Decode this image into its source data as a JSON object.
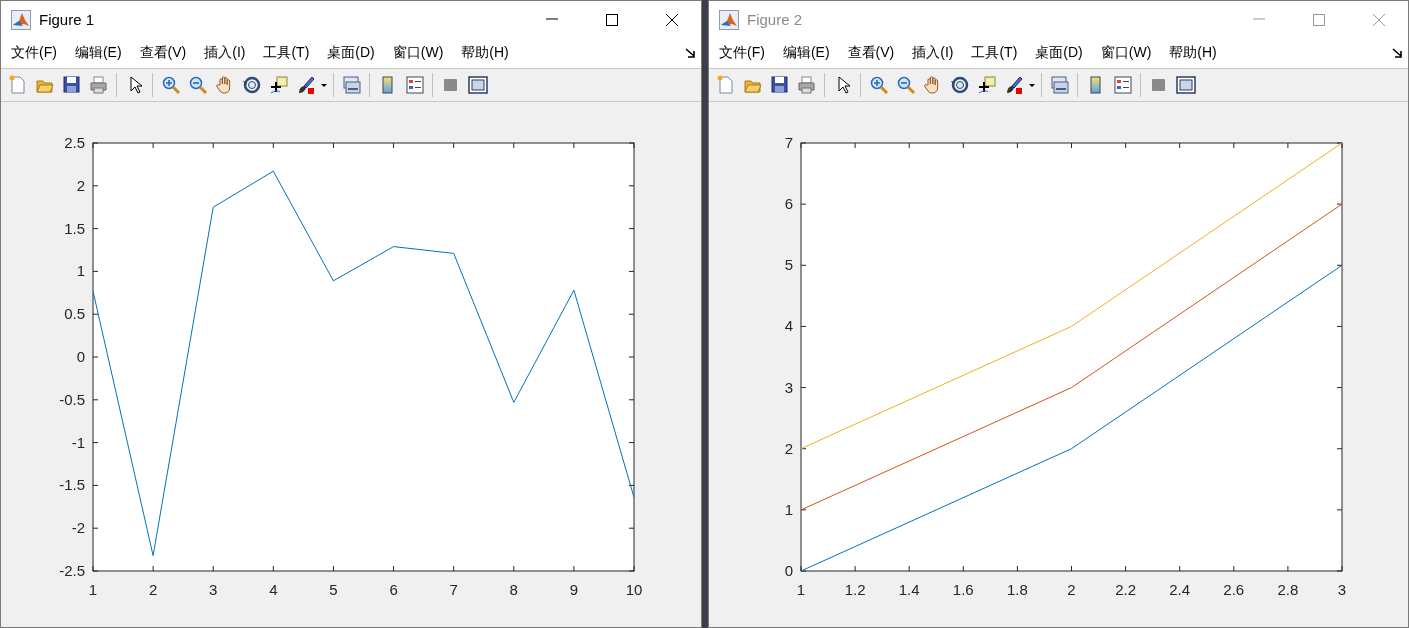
{
  "windows": [
    {
      "title": "Figure 1",
      "active": true,
      "menu": [
        "文件(F)",
        "编辑(E)",
        "查看(V)",
        "插入(I)",
        "工具(T)",
        "桌面(D)",
        "窗口(W)",
        "帮助(H)"
      ],
      "chart_data": {
        "type": "line",
        "x": [
          1,
          2,
          3,
          4,
          5,
          6,
          7,
          8,
          9,
          10
        ],
        "series": [
          {
            "color": "#0072bd",
            "values": [
              0.77,
              -2.32,
              1.75,
              2.17,
              0.89,
              1.29,
              1.21,
              -0.53,
              0.78,
              -1.64
            ]
          }
        ],
        "xlim": [
          1,
          10
        ],
        "ylim": [
          -2.5,
          2.5
        ],
        "xticks": [
          1,
          2,
          3,
          4,
          5,
          6,
          7,
          8,
          9,
          10
        ],
        "yticks": [
          -2.5,
          -2,
          -1.5,
          -1,
          -0.5,
          0,
          0.5,
          1,
          1.5,
          2,
          2.5
        ]
      }
    },
    {
      "title": "Figure 2",
      "active": false,
      "menu": [
        "文件(F)",
        "编辑(E)",
        "查看(V)",
        "插入(I)",
        "工具(T)",
        "桌面(D)",
        "窗口(W)",
        "帮助(H)"
      ],
      "chart_data": {
        "type": "line",
        "x": [
          1,
          2,
          3
        ],
        "series": [
          {
            "color": "#0072bd",
            "values": [
              0,
              2,
              5
            ]
          },
          {
            "color": "#d95319",
            "values": [
              1,
              3,
              6
            ]
          },
          {
            "color": "#edb120",
            "values": [
              2,
              4,
              7
            ]
          }
        ],
        "xlim": [
          1,
          3
        ],
        "ylim": [
          0,
          7
        ],
        "xticks": [
          1,
          1.2,
          1.4,
          1.6,
          1.8,
          2,
          2.2,
          2.4,
          2.6,
          2.8,
          3
        ],
        "yticks": [
          0,
          1,
          2,
          3,
          4,
          5,
          6,
          7
        ]
      }
    }
  ]
}
